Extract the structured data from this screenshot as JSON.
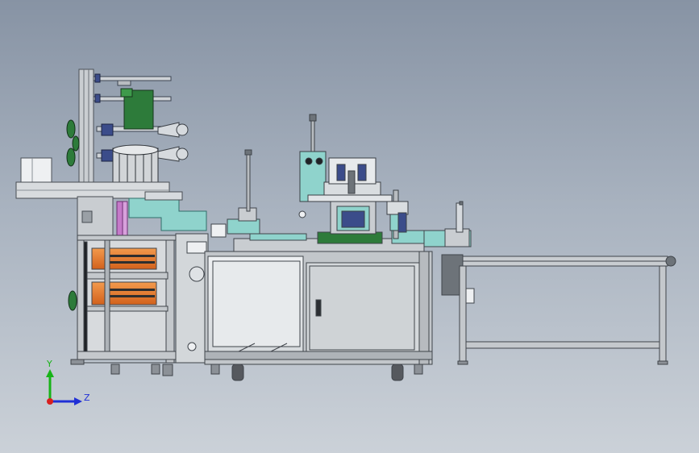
{
  "scene": {
    "colors": {
      "frame": "#c4c8cc",
      "frame_dark": "#6d7379",
      "cabinet": "#d9dde0",
      "panel": "#e9ecee",
      "teal": "#8fd3cc",
      "orange": "#e77a2b",
      "green": "#2d7b3a",
      "blue_part": "#3b4c8a",
      "dark": "#3a3d42"
    }
  },
  "triad": {
    "y_label": "Y",
    "z_label": "Z",
    "y_color": "#17b317",
    "z_color": "#1f2fd6",
    "origin_color": "#d81f1f"
  }
}
